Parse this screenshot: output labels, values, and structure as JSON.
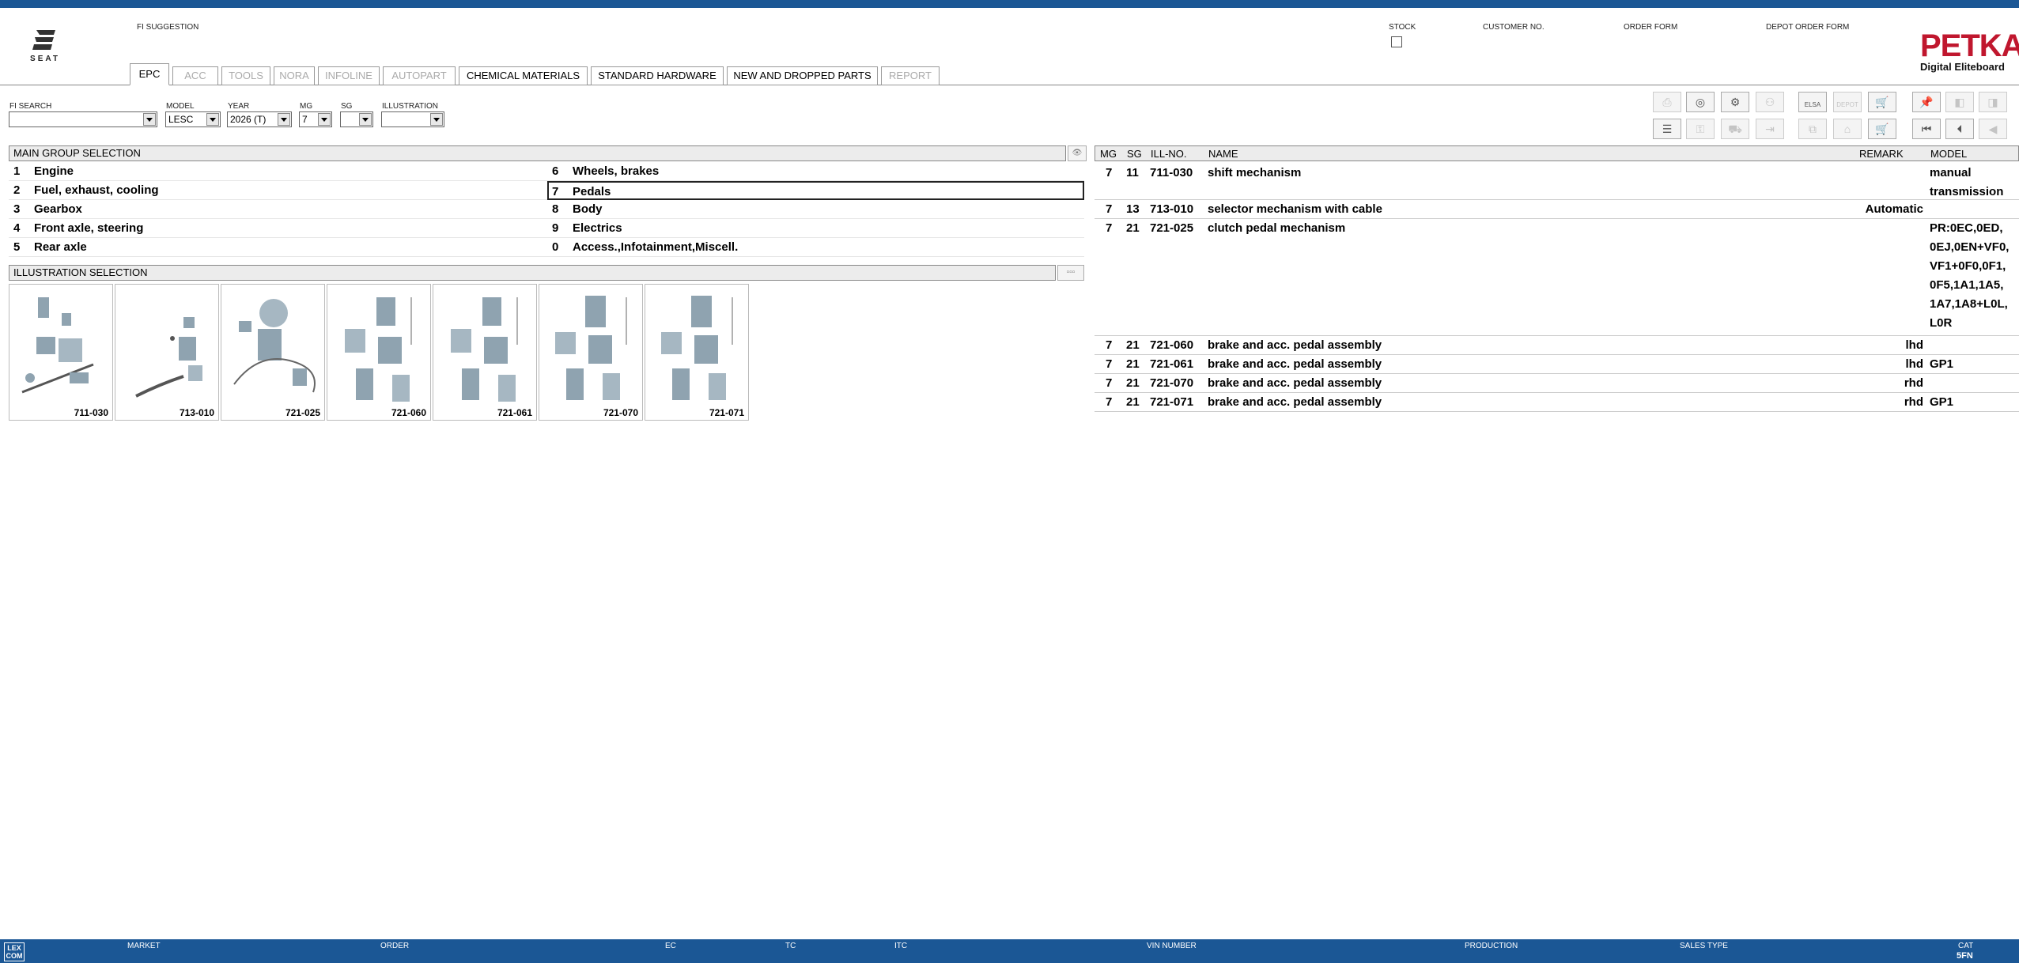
{
  "header": {
    "brand": "SEAT",
    "fi_suggestion_label": "FI SUGGESTION",
    "stock_label": "STOCK",
    "customer_no_label": "CUSTOMER NO.",
    "order_form_label": "ORDER FORM",
    "depot_order_form_label": "DEPOT ORDER FORM",
    "petka_title": "PETKA",
    "petka_subtitle": "Digital Eliteboard"
  },
  "tabs": [
    {
      "label": "EPC",
      "state": "active"
    },
    {
      "label": "ACC",
      "state": "disabled"
    },
    {
      "label": "TOOLS",
      "state": "disabled"
    },
    {
      "label": "NORA",
      "state": "disabled"
    },
    {
      "label": "INFOLINE",
      "state": "disabled"
    },
    {
      "label": "AUTOPART",
      "state": "disabled"
    },
    {
      "label": "CHEMICAL MATERIALS",
      "state": "enabled"
    },
    {
      "label": "STANDARD HARDWARE",
      "state": "enabled"
    },
    {
      "label": "NEW AND DROPPED PARTS",
      "state": "enabled"
    },
    {
      "label": "REPORT",
      "state": "disabled"
    }
  ],
  "filters": {
    "fi_search": {
      "label": "FI SEARCH",
      "value": ""
    },
    "model": {
      "label": "MODEL",
      "value": "LESC"
    },
    "year": {
      "label": "YEAR",
      "value": "2026 (T)"
    },
    "mg": {
      "label": "MG",
      "value": "7"
    },
    "sg": {
      "label": "SG",
      "value": ""
    },
    "illustration": {
      "label": "ILLUSTRATION",
      "value": ""
    }
  },
  "toolbar": {
    "elsa_label": "ELSA",
    "depot_label": "DEPOT"
  },
  "main_group": {
    "title": "MAIN GROUP SELECTION",
    "left": [
      {
        "num": "1",
        "label": "Engine"
      },
      {
        "num": "2",
        "label": "Fuel, exhaust, cooling"
      },
      {
        "num": "3",
        "label": "Gearbox"
      },
      {
        "num": "4",
        "label": "Front axle, steering"
      },
      {
        "num": "5",
        "label": "Rear axle"
      }
    ],
    "right": [
      {
        "num": "6",
        "label": "Wheels, brakes"
      },
      {
        "num": "7",
        "label": "Pedals"
      },
      {
        "num": "8",
        "label": "Body"
      },
      {
        "num": "9",
        "label": "Electrics"
      },
      {
        "num": "0",
        "label": "Access.,Infotainment,Miscell."
      }
    ]
  },
  "illustration_selection": {
    "title": "ILLUSTRATION SELECTION",
    "items": [
      "711-030",
      "713-010",
      "721-025",
      "721-060",
      "721-061",
      "721-070",
      "721-071"
    ]
  },
  "parts_table": {
    "headers": {
      "mg": "MG",
      "sg": "SG",
      "ill": "ILL-NO.",
      "name": "NAME",
      "remark": "REMARK",
      "model": "MODEL"
    },
    "rows": [
      {
        "mg": "7",
        "sg": "11",
        "ill": "711-030",
        "name": "shift mechanism",
        "remark": "",
        "model": "manual\ntransmission"
      },
      {
        "mg": "7",
        "sg": "13",
        "ill": "713-010",
        "name": "selector mechanism with cable",
        "remark": "Automatic",
        "model": ""
      },
      {
        "mg": "7",
        "sg": "21",
        "ill": "721-025",
        "name": "clutch pedal mechanism",
        "remark": "",
        "model": "PR:0EC,0ED,\n0EJ,0EN+VF0,\nVF1+0F0,0F1,\n0F5,1A1,1A5,\n1A7,1A8+L0L,\nL0R"
      },
      {
        "mg": "7",
        "sg": "21",
        "ill": "721-060",
        "name": "brake and acc. pedal assembly",
        "remark": "lhd",
        "model": ""
      },
      {
        "mg": "7",
        "sg": "21",
        "ill": "721-061",
        "name": "brake and acc. pedal assembly",
        "remark": "lhd",
        "model": "GP1"
      },
      {
        "mg": "7",
        "sg": "21",
        "ill": "721-070",
        "name": "brake and acc. pedal assembly",
        "remark": "rhd",
        "model": ""
      },
      {
        "mg": "7",
        "sg": "21",
        "ill": "721-071",
        "name": "brake and acc. pedal assembly",
        "remark": "rhd",
        "model": "GP1"
      }
    ]
  },
  "status": {
    "lexcom": "LEX COM",
    "market": "MARKET",
    "order": "ORDER",
    "ec": "EC",
    "tc": "TC",
    "itc": "ITC",
    "vin_number": "VIN NUMBER",
    "production": "PRODUCTION",
    "sales_type": "SALES TYPE",
    "cat": "CAT",
    "cat_value": "5FN"
  },
  "colors": {
    "brand_blue": "#1b5795",
    "petka_red": "#c0172e"
  }
}
